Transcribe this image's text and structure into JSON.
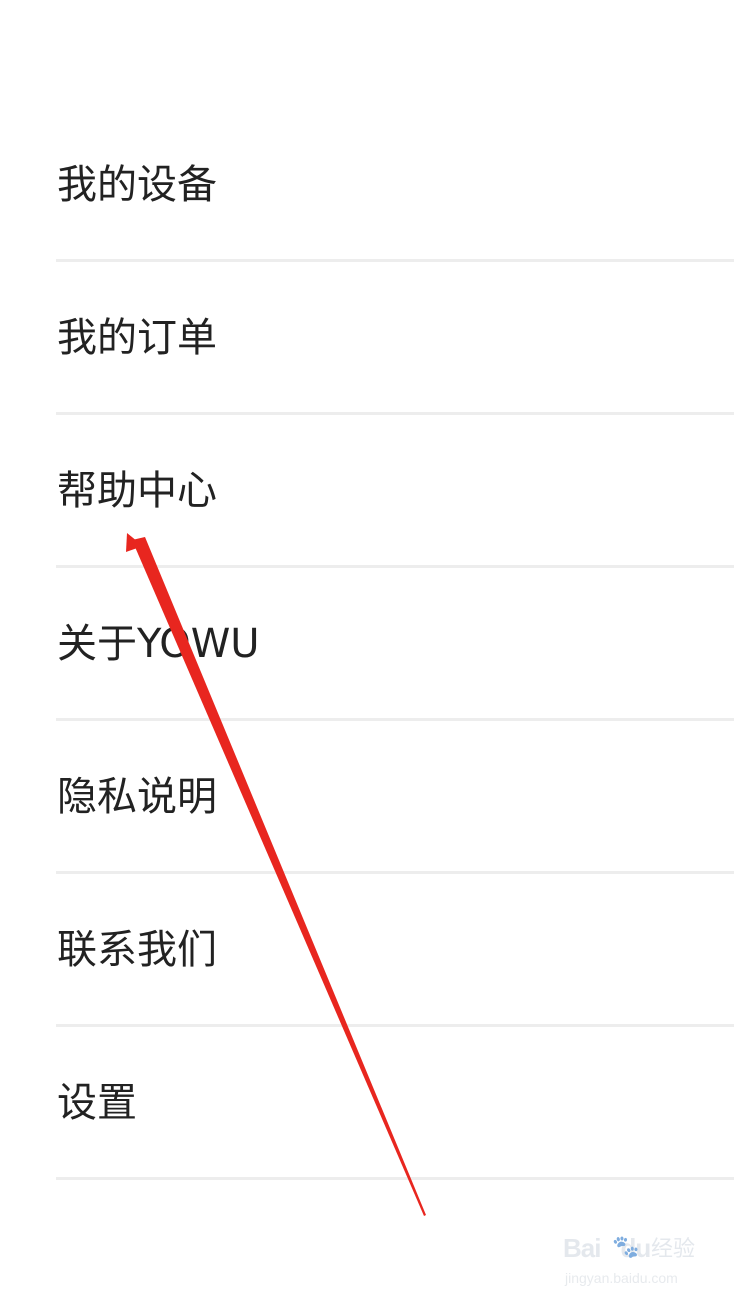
{
  "menu": {
    "items": [
      {
        "label": "我的设备"
      },
      {
        "label": "我的订单"
      },
      {
        "label": "帮助中心"
      },
      {
        "label": "关于YOWU"
      },
      {
        "label": "隐私说明"
      },
      {
        "label": "联系我们"
      },
      {
        "label": "设置"
      }
    ]
  },
  "annotation": {
    "arrow_color": "#e8261f",
    "icon": "arrow-pointer-icon"
  },
  "watermark": {
    "brand": "Bai",
    "brand_tail": "du",
    "product": "经验",
    "url": "jingyan.baidu.com"
  },
  "colors": {
    "background": "#ffffff",
    "text": "#222222",
    "divider": "#ededed"
  }
}
